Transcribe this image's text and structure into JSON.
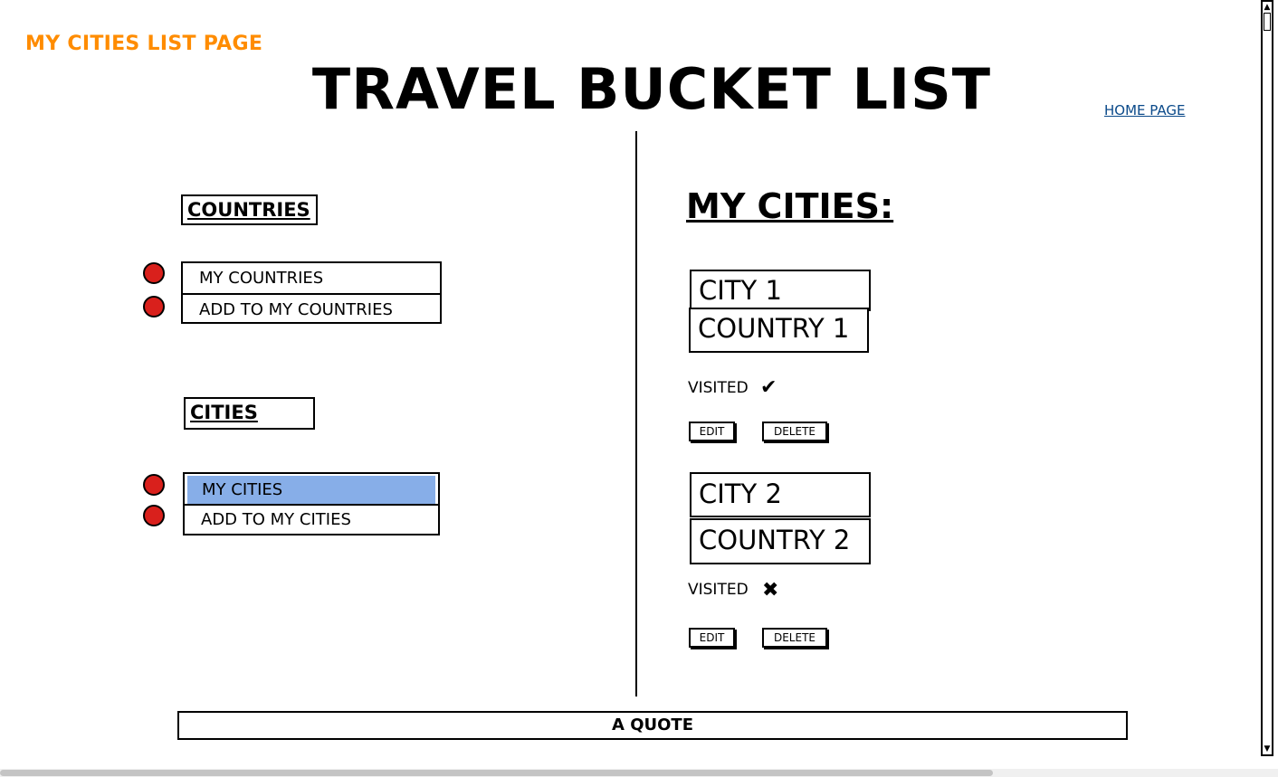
{
  "page_label": "MY CITIES LIST PAGE",
  "title": "TRAVEL BUCKET LIST",
  "home_link": "HOME PAGE",
  "colors": {
    "page_label": "#ff8c00",
    "selected_item": "#87aee8",
    "bullet": "#d9201c",
    "link": "#0b4a8a"
  },
  "countries_section": {
    "title": "COUNTRIES",
    "items": [
      {
        "label": "MY COUNTRIES",
        "selected": false
      },
      {
        "label": "ADD TO MY COUNTRIES",
        "selected": false
      }
    ]
  },
  "cities_section": {
    "title": "CITIES",
    "items": [
      {
        "label": "MY CITIES",
        "selected": true
      },
      {
        "label": "ADD TO MY CITIES",
        "selected": false
      }
    ]
  },
  "my_cities": {
    "heading": "MY CITIES:",
    "cards": [
      {
        "city": "CITY 1",
        "country": "COUNTRY 1",
        "visited_label": "VISITED",
        "visited": true,
        "visited_icon": "✔",
        "edit_label": "EDIT",
        "delete_label": "DELETE"
      },
      {
        "city": "CITY 2",
        "country": "COUNTRY 2",
        "visited_label": "VISITED",
        "visited": false,
        "visited_icon": "✖",
        "edit_label": "EDIT",
        "delete_label": "DELETE"
      }
    ]
  },
  "quote": "A QUOTE"
}
